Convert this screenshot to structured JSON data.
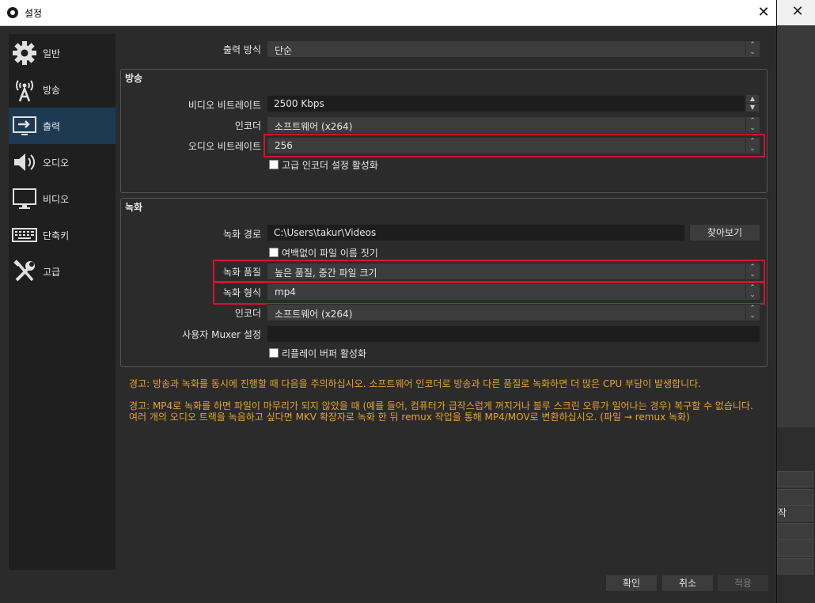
{
  "background_window": {
    "close_glyph": "✕",
    "side_button_label": "작"
  },
  "dialog": {
    "title": "설정",
    "close_glyph": "✕"
  },
  "sidebar": {
    "items": [
      {
        "label": "일반",
        "icon": "gear-icon"
      },
      {
        "label": "방송",
        "icon": "broadcast-icon"
      },
      {
        "label": "출력",
        "icon": "output-icon",
        "active": true
      },
      {
        "label": "오디오",
        "icon": "speaker-icon"
      },
      {
        "label": "비디오",
        "icon": "monitor-icon"
      },
      {
        "label": "단축키",
        "icon": "keyboard-icon"
      },
      {
        "label": "고급",
        "icon": "tools-icon"
      }
    ]
  },
  "output_mode": {
    "label": "출력 방식",
    "value": "단순"
  },
  "stream_group": {
    "title": "방송",
    "video_bitrate": {
      "label": "비디오 비트레이트",
      "value": "2500 Kbps"
    },
    "encoder": {
      "label": "인코더",
      "value": "소프트웨어 (x264)"
    },
    "audio_bitrate": {
      "label": "오디오 비트레이트",
      "value": "256"
    },
    "advanced_encoder": {
      "label": "고급 인코더 설정 활성화",
      "checked": false
    }
  },
  "recording_group": {
    "title": "녹화",
    "path": {
      "label": "녹화 경로",
      "value": "C:\\Users\\takur\\Videos"
    },
    "browse_label": "찾아보기",
    "no_space_names": {
      "label": "여백없이 파일 이름 짓기",
      "checked": false
    },
    "quality": {
      "label": "녹화 품질",
      "value": "높은 품질, 중간 파일 크기"
    },
    "format": {
      "label": "녹화 형식",
      "value": "mp4"
    },
    "encoder": {
      "label": "인코더",
      "value": "소프트웨어 (x264)"
    },
    "muxer": {
      "label": "사용자 Muxer 설정",
      "value": ""
    },
    "replay_buffer": {
      "label": "리플레이 버퍼 활성화",
      "checked": false
    }
  },
  "warnings": {
    "warning1": "경고: 방송과 녹화를 동시에 진행할 때 다음을 주의하십시오. 소프트웨어 인코더로 방송과 다른 품질로 녹화하면 더 많은 CPU 부담이 발생합니다.",
    "warning2": "경고: MP4로 녹화를 하면 파일이 마무리가 되지 않았을 때 (예를 들어, 컴퓨터가 급작스럽게 꺼지거나 블루 스크린 오류가 일어나는 경우) 복구할 수 없습니다. 여러 개의 오디오 트랙을 녹음하고 싶다면 MKV 확장자로 녹화 한 뒤 remux 작업을 통해 MP4/MOV로 변환하십시오. (파일 → remux 녹화)"
  },
  "footer": {
    "ok": "확인",
    "cancel": "취소",
    "apply": "적용"
  },
  "colors": {
    "accent_active": "#1e3a52",
    "warning_text": "#e6a52c",
    "highlight_border": "#d4142a"
  }
}
